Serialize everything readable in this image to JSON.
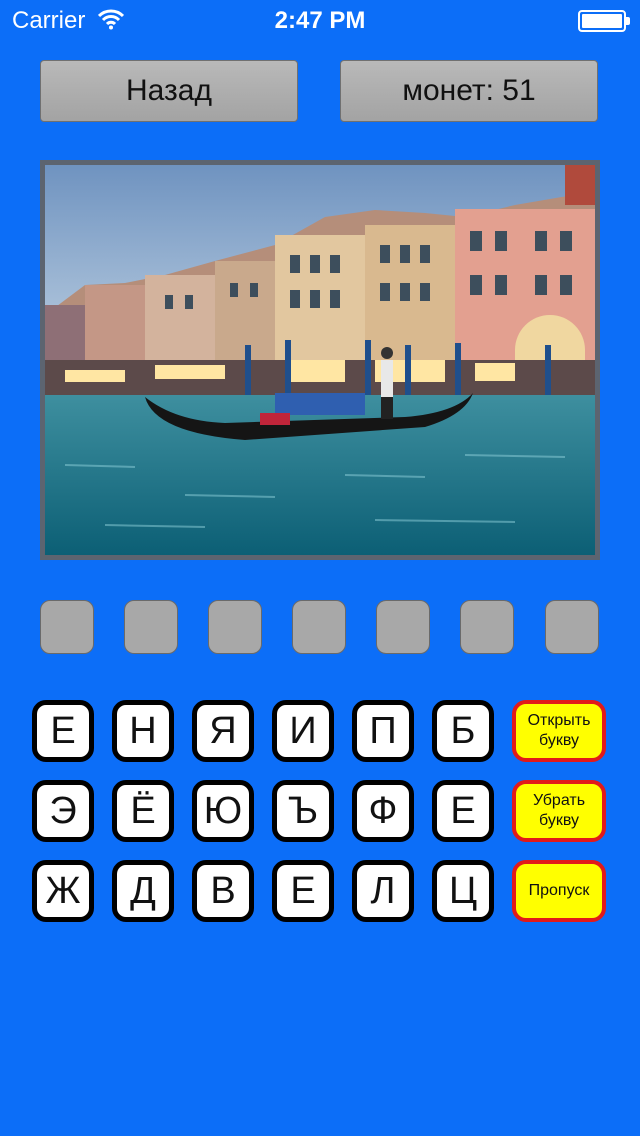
{
  "status_bar": {
    "carrier": "Carrier",
    "time": "2:47 PM",
    "icons": [
      "wifi-icon",
      "battery-icon"
    ]
  },
  "header": {
    "back_label": "Назад",
    "coins_label": "монет: 51"
  },
  "puzzle": {
    "image_icon": "venice-canal-photo",
    "answer_slot_count": 7
  },
  "keyboard": {
    "rows": [
      [
        "Е",
        "Н",
        "Я",
        "И",
        "П",
        "Б"
      ],
      [
        "Э",
        "Ё",
        "Ю",
        "Ъ",
        "Ф",
        "Е"
      ],
      [
        "Ж",
        "Д",
        "В",
        "Е",
        "Л",
        "Ц"
      ]
    ],
    "actions": {
      "reveal_label": "Открыть букву",
      "remove_label": "Убрать букву",
      "skip_label": "Пропуск"
    }
  },
  "colors": {
    "background": "#0c6ef8",
    "help_button_fill": "#ffff00",
    "help_button_border": "#e21a1a"
  }
}
